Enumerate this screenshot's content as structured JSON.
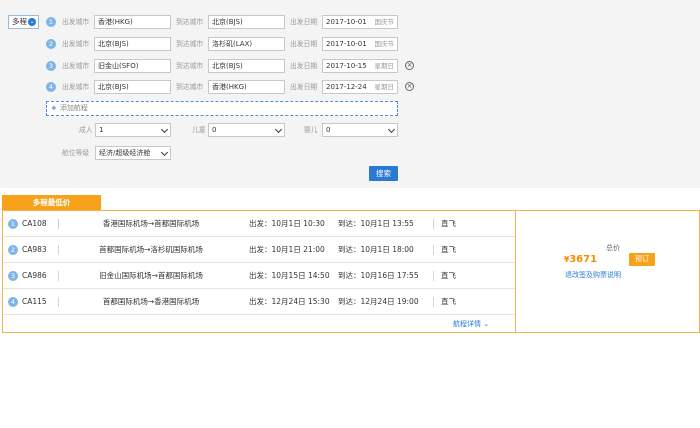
{
  "search": {
    "mode": "多程",
    "labels": {
      "from": "出发城市",
      "to": "到达城市",
      "date": "出发日期"
    },
    "legs": [
      {
        "num": "1",
        "from": "香港(HKG)",
        "to": "北京(BJS)",
        "date": "2017-10-01",
        "date_hint": "国庆节",
        "removable": false
      },
      {
        "num": "2",
        "from": "北京(BJS)",
        "to": "洛杉矶(LAX)",
        "date": "2017-10-01",
        "date_hint": "国庆节",
        "removable": false
      },
      {
        "num": "3",
        "from": "旧金山(SFO)",
        "to": "北京(BJS)",
        "date": "2017-10-15",
        "date_hint": "星期日",
        "removable": true
      },
      {
        "num": "4",
        "from": "北京(BJS)",
        "to": "香港(HKG)",
        "date": "2017-12-24",
        "date_hint": "星期日",
        "removable": true
      }
    ],
    "add_leg_label": "添加航程",
    "passengers": {
      "adult_label": "成人",
      "adult_value": "1",
      "child_label": "儿童",
      "child_value": "0",
      "infant_label": "婴儿",
      "infant_value": "0"
    },
    "cabin_label": "舱位等级",
    "cabin_value": "经济/超级经济舱",
    "search_button": "搜索"
  },
  "results": {
    "tab_label": "多程最低价",
    "flights": [
      {
        "num": "1",
        "flight_no": "CA108",
        "route": "香港国际机场→首都国际机场",
        "depart": "出发：10月1日 10:30",
        "arrive": "到达：10月1日 13:55",
        "type": "直飞"
      },
      {
        "num": "2",
        "flight_no": "CA983",
        "route": "首都国际机场→洛杉矶国际机场",
        "depart": "出发：10月1日 21:00",
        "arrive": "到达：10月1日 18:00",
        "type": "直飞"
      },
      {
        "num": "3",
        "flight_no": "CA986",
        "route": "旧金山国际机场→首都国际机场",
        "depart": "出发：10月15日 14:50",
        "arrive": "到达：10月16日 17:55",
        "type": "直飞"
      },
      {
        "num": "4",
        "flight_no": "CA115",
        "route": "首都国际机场→香港国际机场",
        "depart": "出发：12月24日 15:30",
        "arrive": "到达：12月24日 19:00",
        "type": "直飞"
      }
    ],
    "detail_link": "航程详情",
    "total_label": "总价",
    "currency": "¥",
    "price": "3671",
    "book_button": "预订",
    "rules_link": "退改签及购票说明"
  },
  "colors": {
    "accent_blue": "#2a7ad4",
    "accent_orange": "#f8a21c",
    "price_orange": "#f58c00"
  }
}
